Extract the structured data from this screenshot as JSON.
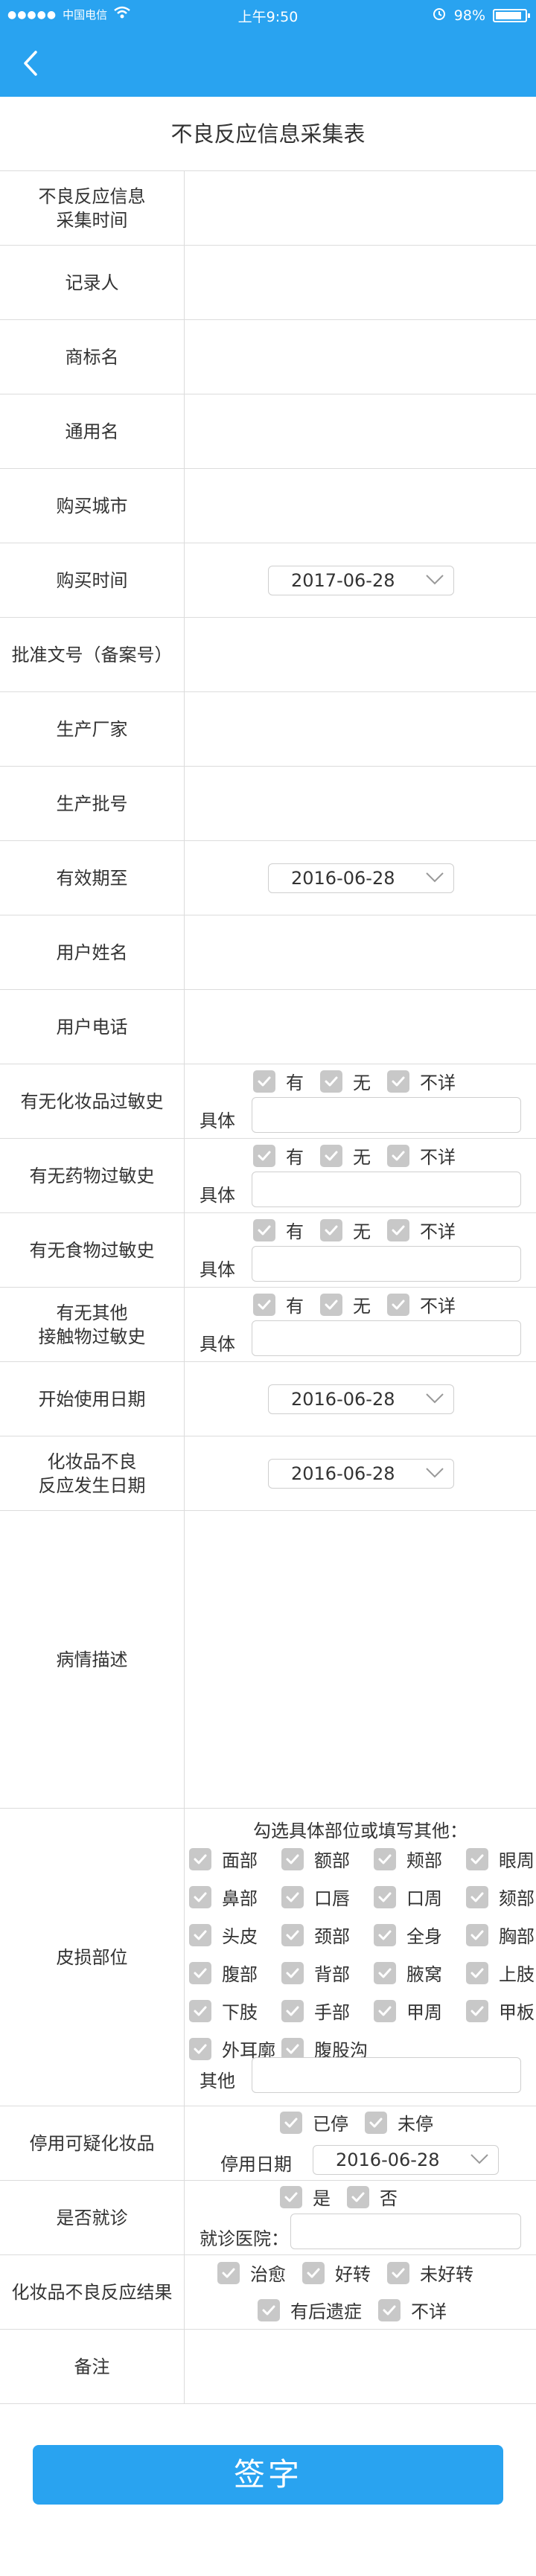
{
  "status_bar": {
    "carrier": "中国电信",
    "time": "上午9:50",
    "battery": "98%"
  },
  "form": {
    "title": "不良反应信息采集表",
    "fields": {
      "collect_time": "不良反应信息\n采集时间",
      "recorder": "记录人",
      "brand_name": "商标名",
      "generic_name": "通用名",
      "purchase_city": "购买城市",
      "purchase_time": "购买时间",
      "approval_no": "批准文号（备案号）",
      "manufacturer": "生产厂家",
      "batch_no": "生产批号",
      "expiry": "有效期至",
      "user_name": "用户姓名",
      "user_phone": "用户电话",
      "cosmetic_allergy": "有无化妆品过敏史",
      "drug_allergy": "有无药物过敏史",
      "food_allergy": "有无食物过敏史",
      "contact_allergy": "有无其他\n接触物过敏史",
      "start_use_date": "开始使用日期",
      "reaction_date": "化妆品不良\n反应发生日期",
      "condition_desc": "病情描述",
      "skin_site": "皮损部位",
      "stop_use": "停用可疑化妆品",
      "seen_doctor": "是否就诊",
      "outcome": "化妆品不良反应结果",
      "remarks": "备注"
    },
    "values": {
      "purchase_time": "2017-06-28",
      "expiry": "2016-06-28",
      "start_use_date": "2016-06-28",
      "reaction_date": "2016-06-28",
      "stop_date": "2016-06-28"
    },
    "allergy_options": [
      "有",
      "无",
      "不详"
    ],
    "detail_label": "具体",
    "skin_hint": "勾选具体部位或填写其他：",
    "skin_sites": [
      "面部",
      "额部",
      "颊部",
      "眼周",
      "鼻部",
      "口唇",
      "口周",
      "颏部",
      "头皮",
      "颈部",
      "全身",
      "胸部",
      "腹部",
      "背部",
      "腋窝",
      "上肢",
      "下肢",
      "手部",
      "甲周",
      "甲板",
      "外耳廓",
      "腹股沟"
    ],
    "other_label": "其他",
    "stop_options": [
      "已停",
      "未停"
    ],
    "stop_date_label": "停用日期",
    "doctor_options": [
      "是",
      "否"
    ],
    "hospital_label": "就诊医院：",
    "outcome_options_row1": [
      "治愈",
      "好转",
      "未好转"
    ],
    "outcome_options_row2": [
      "有后遗症",
      "不详"
    ],
    "sign_button": "签字"
  }
}
